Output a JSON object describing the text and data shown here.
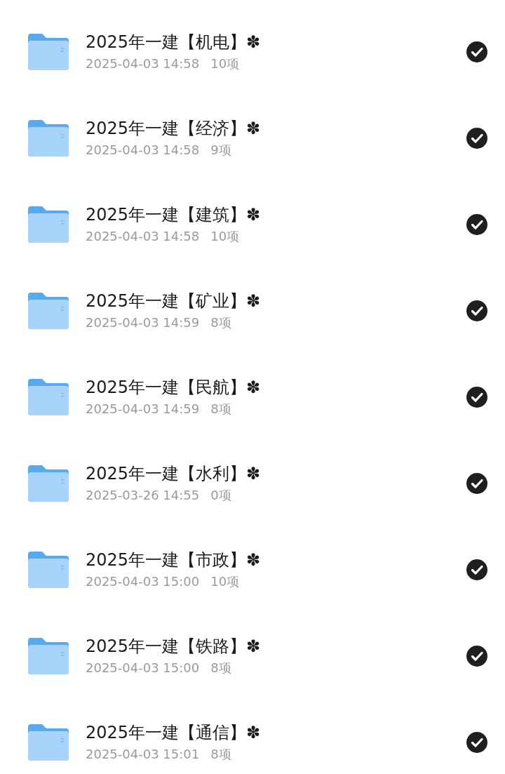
{
  "folders": [
    {
      "title": "2025年一建【机电】✽",
      "date": "2025-04-03 14:58",
      "count": "10项",
      "checked": true
    },
    {
      "title": "2025年一建【经济】✽",
      "date": "2025-04-03 14:58",
      "count": "9项",
      "checked": true
    },
    {
      "title": "2025年一建【建筑】✽",
      "date": "2025-04-03 14:58",
      "count": "10项",
      "checked": true
    },
    {
      "title": "2025年一建【矿业】✽",
      "date": "2025-04-03 14:59",
      "count": "8项",
      "checked": true
    },
    {
      "title": "2025年一建【民航】✽",
      "date": "2025-04-03 14:59",
      "count": "8项",
      "checked": true
    },
    {
      "title": "2025年一建【水利】✽",
      "date": "2025-03-26 14:55",
      "count": "0项",
      "checked": true
    },
    {
      "title": "2025年一建【市政】✽",
      "date": "2025-04-03 15:00",
      "count": "10项",
      "checked": true
    },
    {
      "title": "2025年一建【铁路】✽",
      "date": "2025-04-03 15:00",
      "count": "8项",
      "checked": true
    },
    {
      "title": "2025年一建【通信】✽",
      "date": "2025-04-03 15:01",
      "count": "8项",
      "checked": true
    }
  ]
}
